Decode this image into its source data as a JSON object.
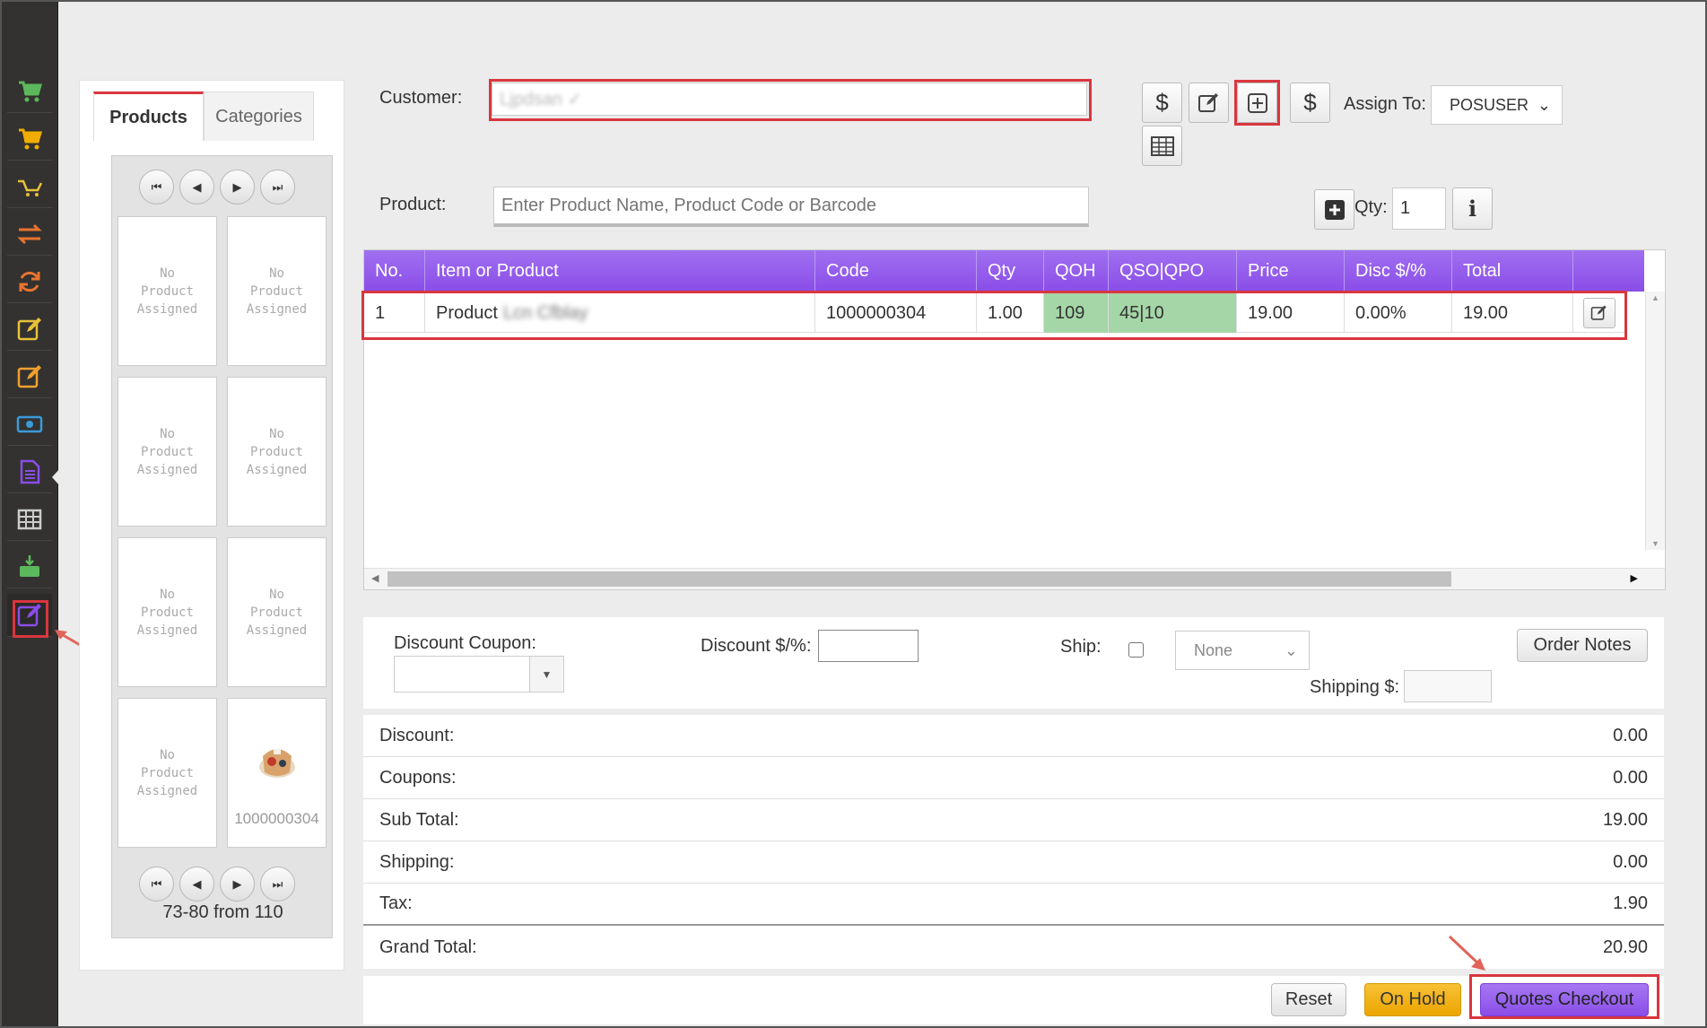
{
  "sidebar": {
    "icons": [
      "cart-icon",
      "cart-icon",
      "cart-outline-icon",
      "transfer-icon",
      "refresh-icon",
      "edit-icon",
      "edit-icon",
      "cash-icon",
      "document-icon",
      "table-icon",
      "download-register-icon",
      "edit-icon"
    ],
    "colors": [
      "#5cb85c",
      "#f0ad00",
      "#e8c13a",
      "#e8742f",
      "#e8742f",
      "#e8c13a",
      "#f0a030",
      "#3a9ad9",
      "#8a4de8",
      "#cccccc",
      "#5cb85c",
      "#8a4de8"
    ]
  },
  "left_panel": {
    "tabs": [
      "Products",
      "Categories"
    ],
    "no_product": [
      "No",
      "Product",
      "Assigned"
    ],
    "product_code": "1000000304",
    "page_info": "73-80 from 110"
  },
  "customer": {
    "label": "Customer:",
    "value": "Ljpdsan ✓"
  },
  "assign": {
    "label": "Assign To:",
    "value": "POSUSER"
  },
  "product": {
    "label": "Product:",
    "placeholder": "Enter Product Name, Product Code or Barcode",
    "qty_label": "Qty:",
    "qty_value": "1"
  },
  "table": {
    "headers": [
      "No.",
      "Item or Product",
      "Code",
      "Qty",
      "QOH",
      "QSO|QPO",
      "Price",
      "Disc $/%",
      "Total"
    ],
    "rows": [
      {
        "no": "1",
        "item": "Product",
        "item_blur": "Lcn Cfblay",
        "code": "1000000304",
        "qty": "1.00",
        "qoh": "109",
        "qso_qpo": "45|10",
        "price": "19.00",
        "disc": "0.00%",
        "total": "19.00"
      }
    ]
  },
  "discount": {
    "coupon_label": "Discount Coupon:",
    "disc_label": "Discount $/%:",
    "ship_label": "Ship:",
    "ship_option": "None",
    "shipping_label": "Shipping $:",
    "order_notes": "Order Notes"
  },
  "totals": [
    {
      "label": "Discount:",
      "value": "0.00"
    },
    {
      "label": "Coupons:",
      "value": "0.00"
    },
    {
      "label": "Sub Total:",
      "value": "19.00"
    },
    {
      "label": "Shipping:",
      "value": "0.00"
    },
    {
      "label": "Tax:",
      "value": "1.90"
    },
    {
      "label": "Grand Total:",
      "value": "20.90"
    }
  ],
  "actions": {
    "reset": "Reset",
    "on_hold": "On Hold",
    "checkout": "Quotes Checkout"
  }
}
